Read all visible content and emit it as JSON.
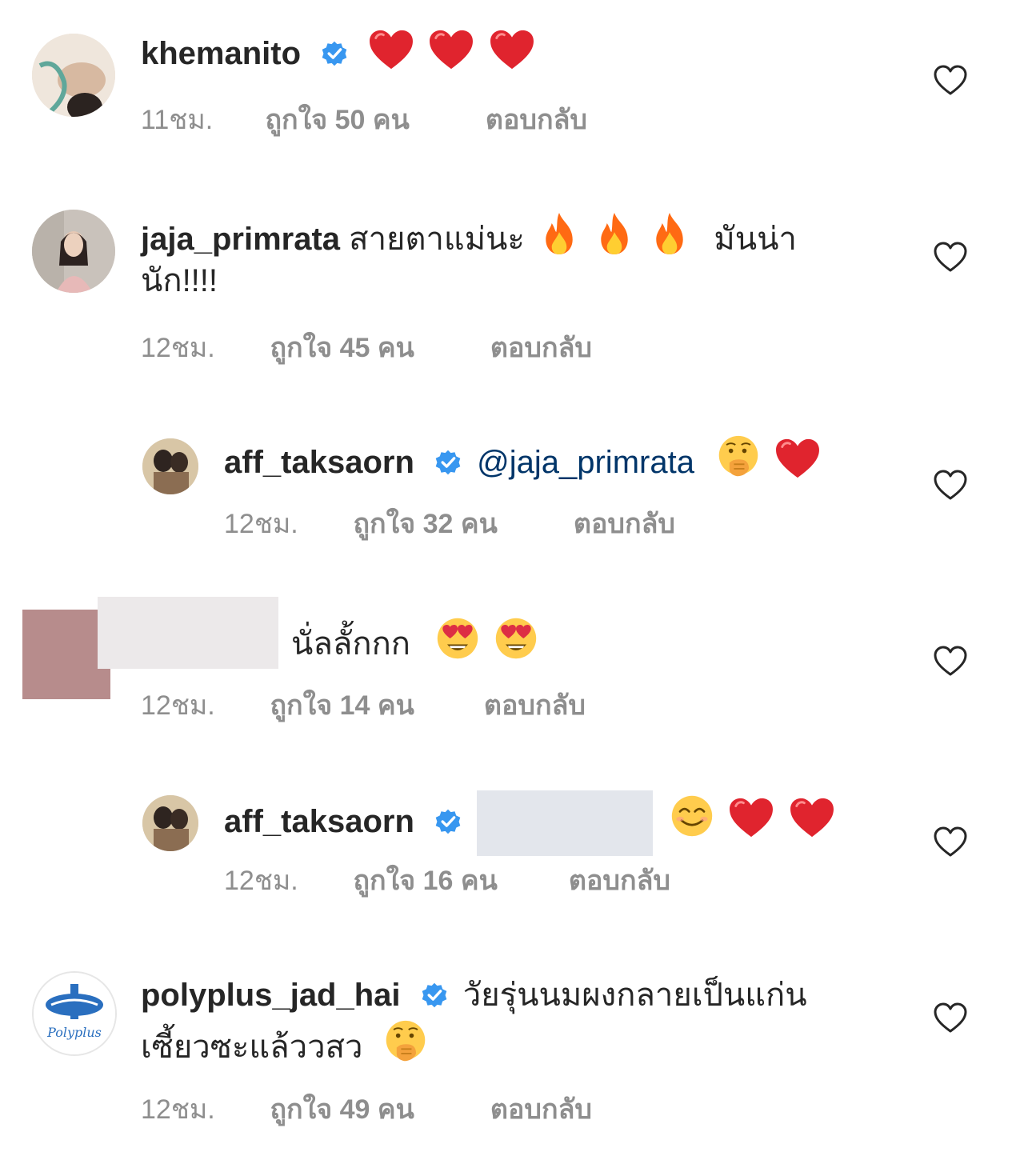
{
  "comments": [
    {
      "username": "khemanito",
      "verified": true,
      "text": "",
      "emojis": [
        "red-heart",
        "red-heart",
        "red-heart"
      ],
      "time": "11ชม.",
      "likes": "ถูกใจ 50 คน",
      "reply_label": "ตอบกลับ"
    },
    {
      "username": "jaja_primrata",
      "verified": false,
      "text": "สายตาแม่นะ",
      "emojis": [
        "fire",
        "fire",
        "fire"
      ],
      "text_after": "มันน่า",
      "text_line2": "นัก!!!!",
      "time": "12ชม.",
      "likes": "ถูกใจ 45 คน",
      "reply_label": "ตอบกลับ"
    },
    {
      "username": "aff_taksaorn",
      "verified": true,
      "mention": "@jaja_primrata",
      "emojis": [
        "face-with-hand-over-mouth",
        "red-heart"
      ],
      "time": "12ชม.",
      "likes": "ถูกใจ 32 คน",
      "reply_label": "ตอบกลับ"
    },
    {
      "username": "",
      "redacted": true,
      "text": "นั่ลลั้กกก",
      "emojis": [
        "heart-eyes",
        "heart-eyes"
      ],
      "time": "12ชม.",
      "likes": "ถูกใจ 14 คน",
      "reply_label": "ตอบกลับ"
    },
    {
      "username": "aff_taksaorn",
      "verified": true,
      "mention_redacted": true,
      "emojis": [
        "smiling-face",
        "red-heart",
        "red-heart"
      ],
      "time": "12ชม.",
      "likes": "ถูกใจ 16 คน",
      "reply_label": "ตอบกลับ"
    },
    {
      "username": "polyplus_jad_hai",
      "verified": true,
      "text": "วัยรุ่นนมผงกลายเป็นแก่น",
      "text_line2": "เซี้ยวซะแล้ววสว",
      "emojis": [
        "face-with-hand-over-mouth"
      ],
      "avatar_logo_text": "Polyplus",
      "time": "12ชม.",
      "likes": "ถูกใจ 49 คน",
      "reply_label": "ตอบกลับ"
    }
  ],
  "colors": {
    "verified_blue": "#3897f0",
    "meta_gray": "#8e8e8e",
    "mention_blue": "#003569",
    "heart_red": "#e0242e"
  }
}
